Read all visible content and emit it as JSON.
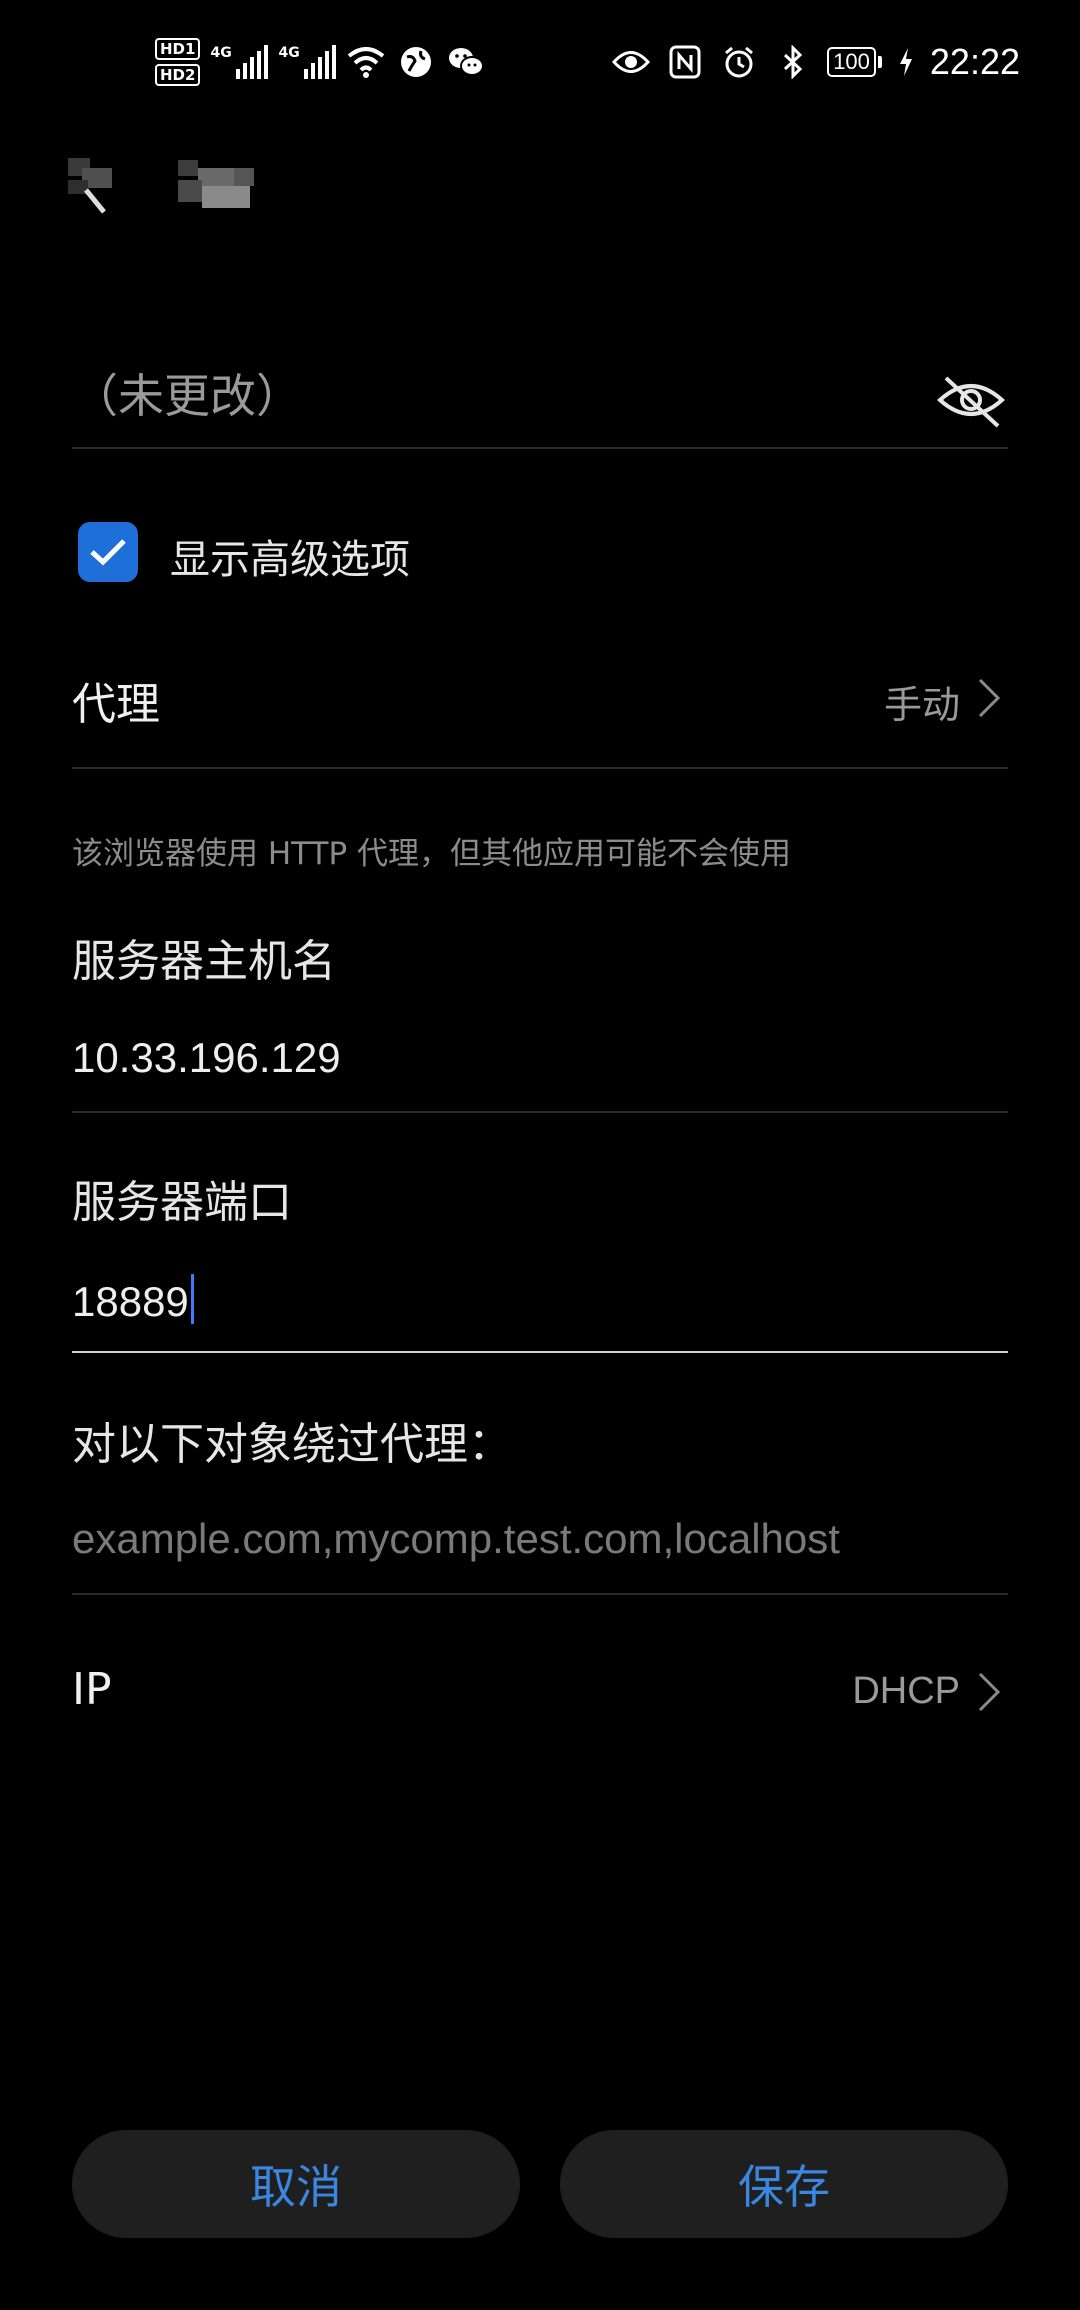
{
  "status_bar": {
    "hd1": "HD1",
    "hd2": "HD2",
    "net1": "4G",
    "net2": "4G",
    "battery": "100",
    "time": "22:22"
  },
  "header": {
    "back_icon": "back-arrow-icon"
  },
  "password": {
    "value": "（未更改）",
    "visibility_icon": "eye-off-icon"
  },
  "advanced": {
    "label": "显示高级选项",
    "checked": true,
    "accent": "#1e6fd8"
  },
  "proxy": {
    "label": "代理",
    "value": "手动"
  },
  "hint": "该浏览器使用 HTTP 代理，但其他应用可能不会使用",
  "hostname": {
    "label": "服务器主机名",
    "value": "10.33.196.129"
  },
  "port": {
    "label": "服务器端口",
    "value": "18889"
  },
  "bypass": {
    "label": "对以下对象绕过代理：",
    "placeholder": "example.com,mycomp.test.com,localhost"
  },
  "ip": {
    "label": "IP",
    "value": "DHCP"
  },
  "buttons": {
    "cancel": "取消",
    "save": "保存",
    "color": "#3b86e0"
  }
}
